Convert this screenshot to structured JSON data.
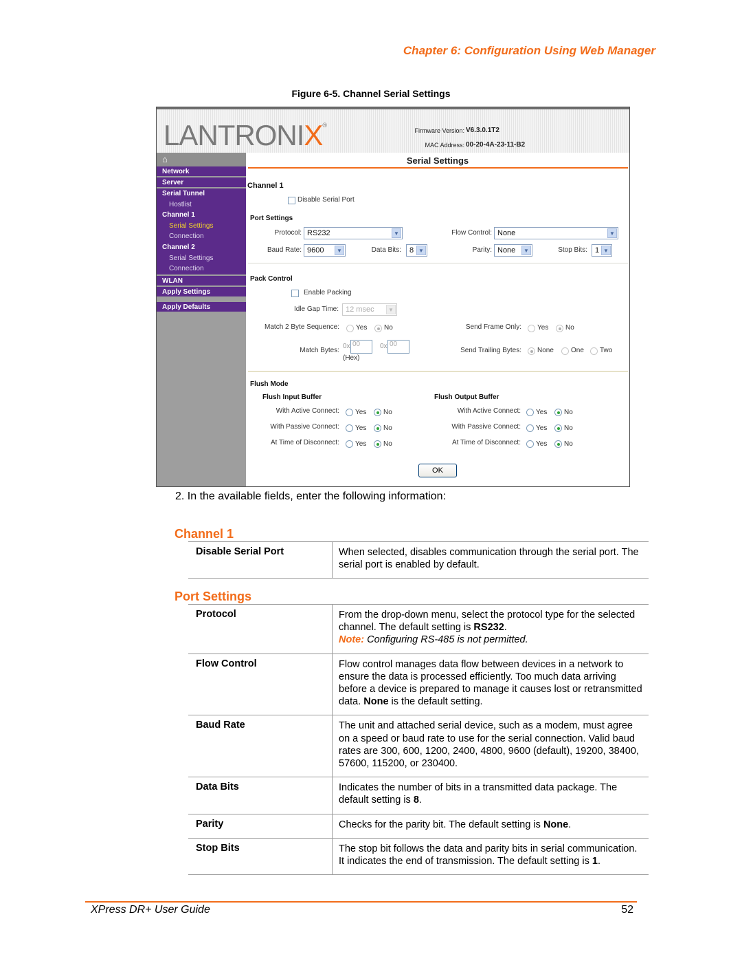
{
  "header": {
    "chapter": "Chapter 6: Configuration Using Web Manager"
  },
  "figure_caption": "Figure 6-5. Channel Serial Settings",
  "screenshot": {
    "logo": {
      "text": "LANTRONI",
      "accent": "X",
      "reg": "®"
    },
    "firmware_label": "Firmware Version:",
    "firmware_value": "V6.3.0.1T2",
    "mac_label": "MAC Address:",
    "mac_value": "00-20-4A-23-11-B2",
    "home_icon": "⌂",
    "nav": {
      "network": "Network",
      "server": "Server",
      "serial_tunnel": "Serial Tunnel",
      "hostlist": "Hostlist",
      "channel1": "Channel 1",
      "ch1_serial": "Serial Settings",
      "ch1_connection": "Connection",
      "channel2": "Channel 2",
      "ch2_serial": "Serial Settings",
      "ch2_connection": "Connection",
      "wlan": "WLAN",
      "apply_settings": "Apply Settings",
      "apply_defaults": "Apply Defaults"
    },
    "title": "Serial Settings",
    "channel_heading": "Channel 1",
    "disable_serial_port": {
      "label": "Disable Serial Port",
      "checked": false
    },
    "port_settings": {
      "heading": "Port Settings",
      "protocol_label": "Protocol:",
      "protocol_value": "RS232",
      "flow_label": "Flow Control:",
      "flow_value": "None",
      "baud_label": "Baud Rate:",
      "baud_value": "9600",
      "databits_label": "Data Bits:",
      "databits_value": "8",
      "parity_label": "Parity:",
      "parity_value": "None",
      "stopbits_label": "Stop Bits:",
      "stopbits_value": "1"
    },
    "pack_control": {
      "heading": "Pack Control",
      "enable_packing": "Enable Packing",
      "idle_gap_label": "Idle Gap Time:",
      "idle_gap_value": "12 msec",
      "match2_label": "Match 2 Byte Sequence:",
      "send_frame_label": "Send Frame Only:",
      "match_bytes_label": "Match Bytes:",
      "hex_prefix": "0x",
      "match_byte1": "00",
      "match_byte2": "00",
      "hex_note": "(Hex)",
      "trailing_label": "Send Trailing Bytes:",
      "yes": "Yes",
      "no": "No",
      "none": "None",
      "one": "One",
      "two": "Two"
    },
    "flush_mode": {
      "heading": "Flush Mode",
      "input_heading": "Flush Input Buffer",
      "output_heading": "Flush Output Buffer",
      "active": "With Active Connect:",
      "passive": "With Passive Connect:",
      "disconnect": "At Time of Disconnect:",
      "yes": "Yes",
      "no": "No"
    },
    "ok_button": "OK"
  },
  "step_text": "2.   In the available fields, enter the following information:",
  "sections": {
    "channel1": {
      "heading": "Channel 1",
      "rows": [
        {
          "field": "Disable Serial Port",
          "desc": "When selected, disables communication through the serial port. The serial port is enabled by default."
        }
      ]
    },
    "port_settings": {
      "heading": "Port Settings",
      "rows": [
        {
          "field": "Protocol",
          "desc_pre": "From the drop-down menu, select the protocol type for the selected channel. The default setting is ",
          "desc_bold": "RS232",
          "desc_post": ".",
          "note_label": "Note:",
          "note_text": " Configuring RS-485 is not permitted."
        },
        {
          "field": "Flow Control",
          "desc_pre": "Flow control manages data flow between devices in a network to ensure the data is processed efficiently. Too much data arriving before a device is prepared to manage it causes lost or retransmitted data. ",
          "desc_bold": "None",
          "desc_post": " is the default setting."
        },
        {
          "field": "Baud Rate",
          "desc": "The unit and attached serial device, such as a modem, must agree on a speed or baud rate to use for the serial connection. Valid baud rates are 300, 600, 1200, 2400, 4800, 9600 (default), 19200, 38400, 57600, 115200, or 230400."
        },
        {
          "field": "Data Bits",
          "desc_pre": "Indicates the number of bits in a transmitted data package. The default setting is ",
          "desc_bold": "8",
          "desc_post": "."
        },
        {
          "field": "Parity",
          "desc_pre": "Checks for the parity bit. The default setting is ",
          "desc_bold": "None",
          "desc_post": "."
        },
        {
          "field": "Stop Bits",
          "desc_pre": "The stop bit follows the data and parity bits in serial communication. It indicates the end of transmission. The default setting is ",
          "desc_bold": "1",
          "desc_post": "."
        }
      ]
    }
  },
  "footer": {
    "title": "XPress DR+ User Guide",
    "page": "52"
  }
}
